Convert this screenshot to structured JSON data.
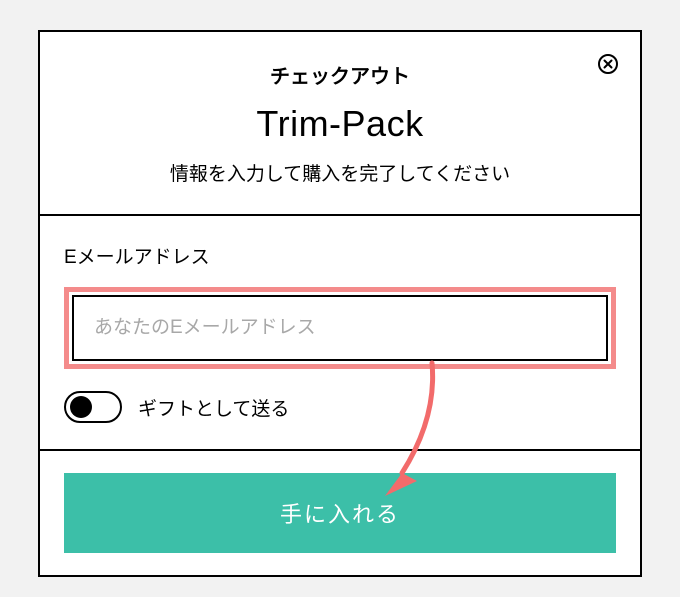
{
  "header": {
    "small_title": "チェックアウト",
    "big_title": "Trim-Pack",
    "subtitle": "情報を入力して購入を完了してください"
  },
  "form": {
    "email_label": "Eメールアドレス",
    "email_placeholder": "あなたのEメールアドレス",
    "gift_label": "ギフトとして送る"
  },
  "footer": {
    "submit_label": "手に入れる"
  },
  "colors": {
    "highlight": "#f48b8b",
    "accent": "#3cbfa8"
  }
}
